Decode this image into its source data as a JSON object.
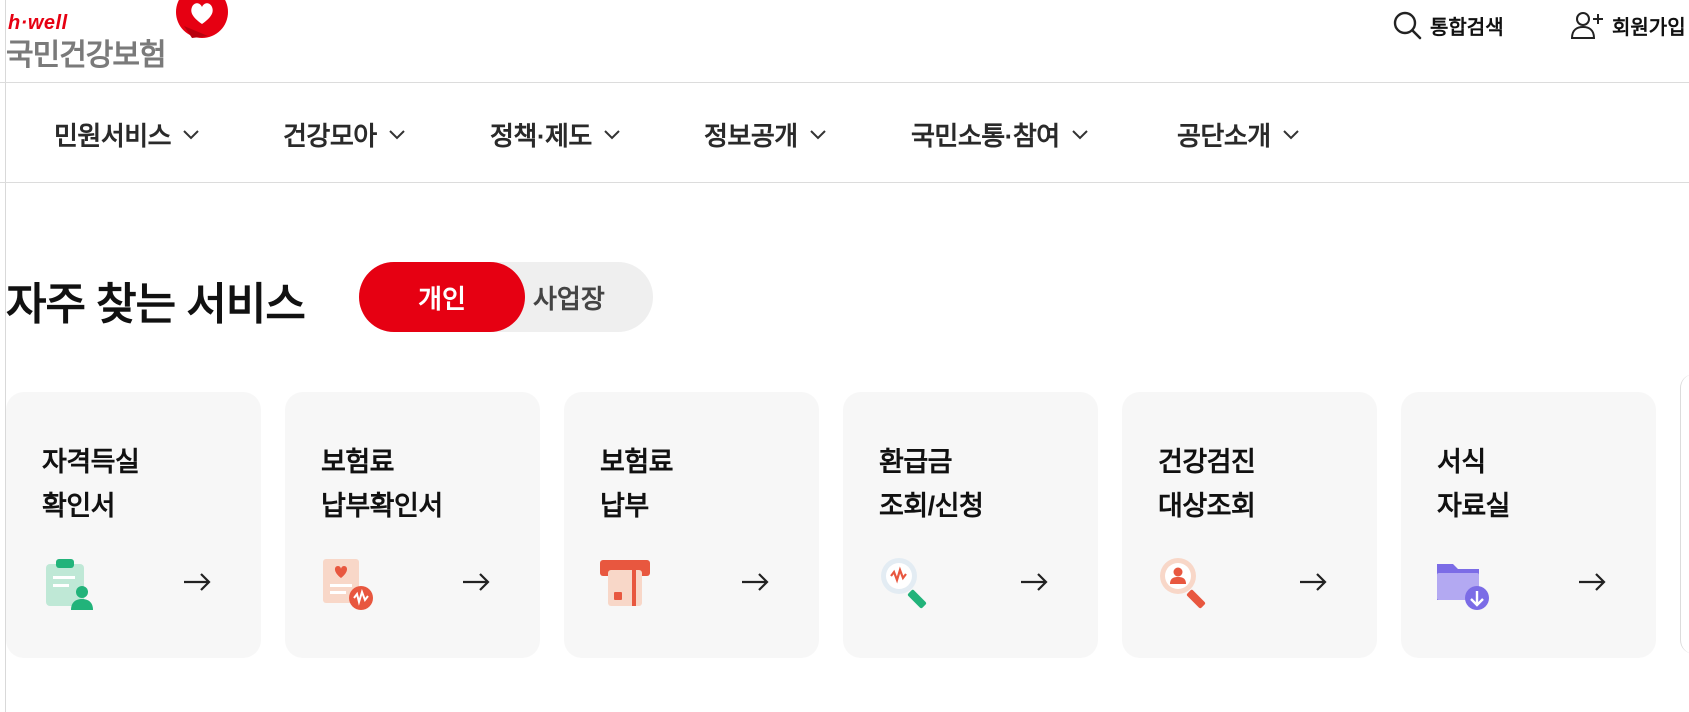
{
  "header": {
    "logo_brand": "h·well",
    "logo_name": "국민건강보험",
    "search_label": "통합검색",
    "join_label": "회원가입"
  },
  "gnb": {
    "items": [
      {
        "label": "민원서비스"
      },
      {
        "label": "건강모아"
      },
      {
        "label": "정책·제도"
      },
      {
        "label": "정보공개"
      },
      {
        "label": "국민소통·참여"
      },
      {
        "label": "공단소개"
      }
    ]
  },
  "section": {
    "title": "자주 찾는 서비스",
    "toggle": {
      "active": "개인",
      "inactive": "사업장"
    }
  },
  "cards": [
    {
      "line1": "자격득실",
      "line2": "확인서",
      "icon": "clipboard-user-icon"
    },
    {
      "line1": "보험료",
      "line2": "납부확인서",
      "icon": "receipt-icon"
    },
    {
      "line1": "보험료",
      "line2": "납부",
      "icon": "card-payment-icon"
    },
    {
      "line1": "환급금",
      "line2": "조회/신청",
      "icon": "magnifier-won-icon"
    },
    {
      "line1": "건강검진",
      "line2": "대상조회",
      "icon": "magnifier-person-icon"
    },
    {
      "line1": "서식",
      "line2": "자료실",
      "icon": "folder-download-icon"
    }
  ],
  "colors": {
    "brand_red": "#e60012",
    "card_bg": "#f7f7f7",
    "toggle_bg": "#efefef"
  }
}
